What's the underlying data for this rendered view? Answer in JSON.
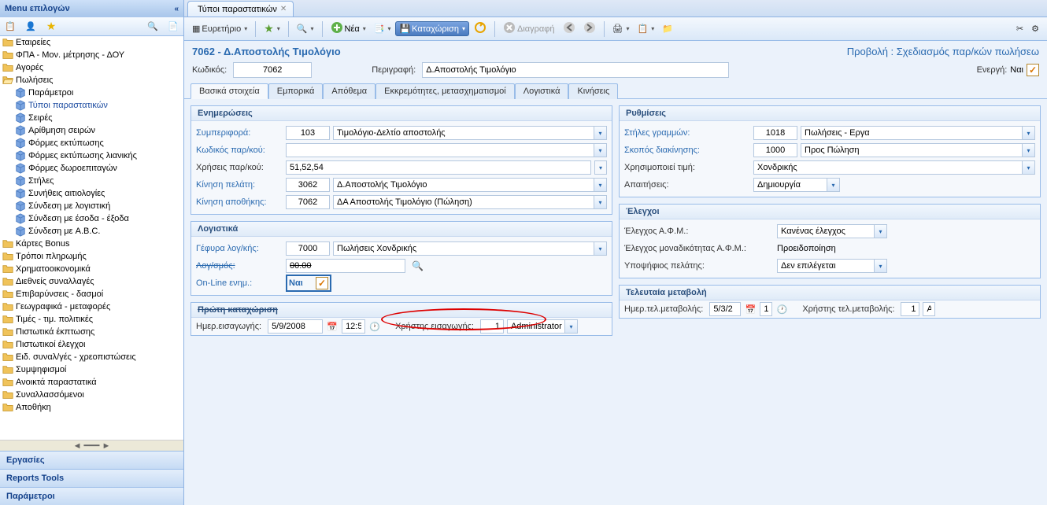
{
  "sidebar": {
    "title": "Menu επιλογών",
    "tree": [
      {
        "type": "folder",
        "label": "Εταιρείες",
        "indent": 0
      },
      {
        "type": "folder",
        "label": "ΦΠΑ - Μον. μέτρησης - ΔΟΥ",
        "indent": 0
      },
      {
        "type": "folder",
        "label": "Αγορές",
        "indent": 0
      },
      {
        "type": "folder-open",
        "label": "Πωλήσεις",
        "indent": 0
      },
      {
        "type": "cube",
        "label": "Παράμετροι",
        "indent": 1
      },
      {
        "type": "cube",
        "label": "Τύποι παραστατικών",
        "indent": 1,
        "selected": true
      },
      {
        "type": "cube",
        "label": "Σειρές",
        "indent": 1
      },
      {
        "type": "cube",
        "label": "Αρίθμηση σειρών",
        "indent": 1
      },
      {
        "type": "cube",
        "label": "Φόρμες εκτύπωσης",
        "indent": 1
      },
      {
        "type": "cube",
        "label": "Φόρμες εκτύπωσης λιανικής",
        "indent": 1
      },
      {
        "type": "cube",
        "label": "Φόρμες δωροεπιταγών",
        "indent": 1
      },
      {
        "type": "cube",
        "label": "Στήλες",
        "indent": 1
      },
      {
        "type": "cube",
        "label": "Συνήθεις αιτιολογίες",
        "indent": 1
      },
      {
        "type": "cube",
        "label": "Σύνδεση με λογιστική",
        "indent": 1
      },
      {
        "type": "cube",
        "label": "Σύνδεση με έσοδα - έξοδα",
        "indent": 1
      },
      {
        "type": "cube",
        "label": "Σύνδεση με A.B.C.",
        "indent": 1
      },
      {
        "type": "folder",
        "label": "Κάρτες Bonus",
        "indent": 0
      },
      {
        "type": "folder",
        "label": "Τρόποι πληρωμής",
        "indent": 0
      },
      {
        "type": "folder",
        "label": "Χρηματοοικονομικά",
        "indent": 0
      },
      {
        "type": "folder",
        "label": "Διεθνείς συναλλαγές",
        "indent": 0
      },
      {
        "type": "folder",
        "label": "Επιβαρύνσεις - δασμοί",
        "indent": 0
      },
      {
        "type": "folder",
        "label": "Γεωγραφικά - μεταφορές",
        "indent": 0
      },
      {
        "type": "folder",
        "label": "Τιμές - τιμ. πολιτικές",
        "indent": 0
      },
      {
        "type": "folder",
        "label": "Πιστωτικά έκπτωσης",
        "indent": 0
      },
      {
        "type": "folder",
        "label": "Πιστωτικοί έλεγχοι",
        "indent": 0
      },
      {
        "type": "folder",
        "label": "Ειδ. συναλ/γές - χρεοπιστώσεις",
        "indent": 0
      },
      {
        "type": "folder",
        "label": "Συμψηφισμοί",
        "indent": 0
      },
      {
        "type": "folder",
        "label": "Ανοικτά παραστατικά",
        "indent": 0
      },
      {
        "type": "folder",
        "label": "Συναλλασσόμενοι",
        "indent": 0
      },
      {
        "type": "folder",
        "label": "Αποθήκη",
        "indent": 0
      }
    ],
    "accordion": [
      {
        "label": "Εργασίες"
      },
      {
        "label": "Reports Tools"
      },
      {
        "label": "Παράμετροι"
      }
    ]
  },
  "tab": {
    "title": "Τύποι παραστατικών"
  },
  "toolbar": {
    "index": "Ευρετήριο",
    "new": "Νέα",
    "save": "Καταχώριση",
    "delete": "Διαγραφή"
  },
  "doc": {
    "title": "7062 - Δ.Αποστολής Τιμολόγιο",
    "viewRight": "Προβολή : Σχεδιασμός παρ/κών πωλήσεω",
    "codeLabel": "Κωδικός:",
    "code": "7062",
    "descLabel": "Περιγραφή:",
    "desc": "Δ.Αποστολής Τιμολόγιο",
    "activeLabel": "Ενεργή:",
    "activeVal": "Ναι"
  },
  "tabs": [
    "Βασικά στοιχεία",
    "Εμπορικά",
    "Απόθεμα",
    "Εκκρεμότητες, μετασχηματισμοί",
    "Λογιστικά",
    "Κινήσεις"
  ],
  "enim": {
    "title": "Ενημερώσεις",
    "behaviorL": "Συμπεριφορά:",
    "behaviorC": "103",
    "behaviorV": "Τιμολόγιο-Δελτίο αποστολής",
    "codeParL": "Κωδικός παρ/κού:",
    "usesL": "Χρήσεις παρ/κού:",
    "usesV": "51,52,54",
    "custMoveL": "Κίνηση πελάτη:",
    "custMoveC": "3062",
    "custMoveV": "Δ.Αποστολής Τιμολόγιο",
    "stockMoveL": "Κίνηση αποθήκης:",
    "stockMoveC": "7062",
    "stockMoveV": "ΔΑ Αποστολής Τιμολόγιο (Πώληση)"
  },
  "settings": {
    "title": "Ρυθμίσεις",
    "colsL": "Στήλες γραμμών:",
    "colsC": "1018",
    "colsV": "Πωλήσεις - Εργα",
    "purposeL": "Σκοπός διακίνησης:",
    "purposeC": "1000",
    "purposeV": "Προς Πώληση",
    "usesPriceL": "Χρησιμοποιεί τιμή:",
    "usesPriceV": "Χονδρικής",
    "reqL": "Απαιτήσεις:",
    "reqV": "Δημιουργία"
  },
  "acct": {
    "title": "Λογιστικά",
    "bridgeL": "Γέφυρα λογ/κής:",
    "bridgeC": "7000",
    "bridgeV": "Πωλήσεις Χονδρικής",
    "acctL": "Λογ/σμός:",
    "acctV": "00.00",
    "onlineL": "On-Line ενημ.:",
    "onlineV": "Ναι"
  },
  "checks": {
    "title": "Έλεγχοι",
    "afmL": "Έλεγχος Α.Φ.Μ.:",
    "afmV": "Κανένας έλεγχος",
    "uniqL": "Έλεγχος μοναδικότητας Α.Φ.Μ.:",
    "uniqV": "Προειδοποίηση",
    "candL": "Υποψήφιος πελάτης:",
    "candV": "Δεν επιλέγεται"
  },
  "first": {
    "title": "Πρώτη καταχώριση",
    "dateL": "Ημερ.εισαγωγής:",
    "dateV": "5/9/2008",
    "timeV": "12:5",
    "userL": "Χρήστης εισαγωγής:",
    "userIdx": "1",
    "userV": "Administrator"
  },
  "last": {
    "title": "Τελευταία μεταβολή",
    "dateL": "Ημερ.τελ.μεταβολής:",
    "dateV": "5/3/2",
    "timeV": "1",
    "userL": "Χρήστης τελ.μεταβολής:",
    "userIdx": "1",
    "userV": "A"
  }
}
